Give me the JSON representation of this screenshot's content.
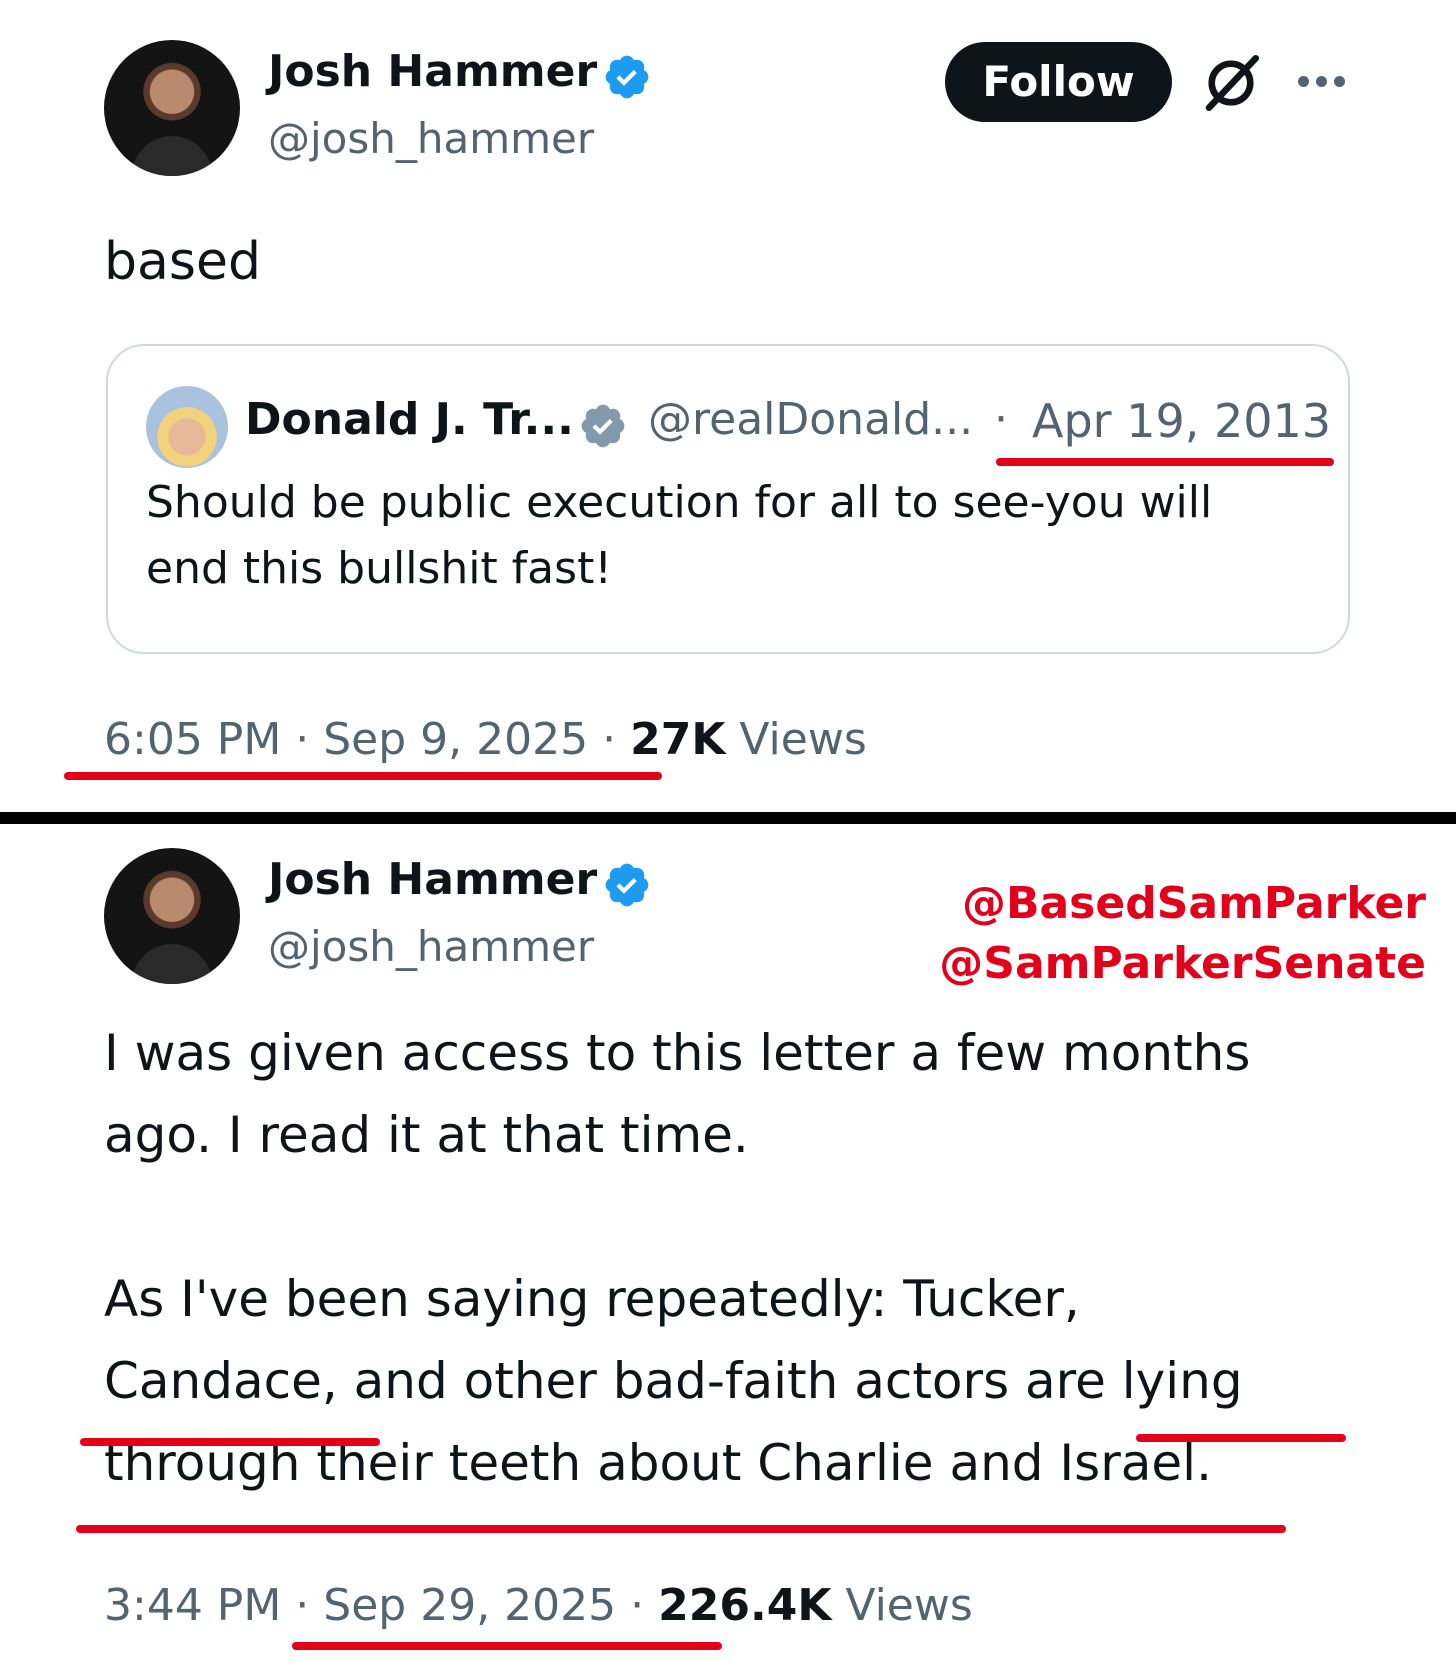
{
  "tweet_top": {
    "author_name": "Josh Hammer",
    "author_handle": "@josh_hammer",
    "follow_label": "Follow",
    "text": "based",
    "quoted": {
      "author_name": "Donald J. Tr...",
      "author_handle": "@realDonald...",
      "separator": "·",
      "date": "Apr 19, 2013",
      "text": "Should be public execution for all to see-you will end this bullshit fast!"
    },
    "timestamp": "6:05 PM · Sep 9, 2025 ·",
    "views_count": "27K",
    "views_label": "Views"
  },
  "tweet_bottom": {
    "author_name": "Josh Hammer",
    "author_handle": "@josh_hammer",
    "paragraph1_line1": "I was given access to this letter a few months",
    "paragraph1_line2": "ago. I read it at that time.",
    "paragraph2_line1": "As I've been saying repeatedly: Tucker,",
    "paragraph2_line2": "Candace, and other bad-faith actors are lying",
    "paragraph2_line3": "through their teeth about Charlie and Israel.",
    "time": "3:44 PM",
    "sep1": "·",
    "date": "Sep 29, 2025",
    "sep2": "·",
    "views_count": "226.4K",
    "views_label": "Views"
  },
  "watermark": {
    "line1": "@BasedSamParker",
    "line2": "@SamParkerSenate"
  },
  "colors": {
    "verified_blue": "#1d9bf0",
    "annotation_red": "#e3001b",
    "secondary_text": "#536471"
  },
  "icons": [
    "verified-badge-icon",
    "grok-icon",
    "more-options-icon"
  ]
}
